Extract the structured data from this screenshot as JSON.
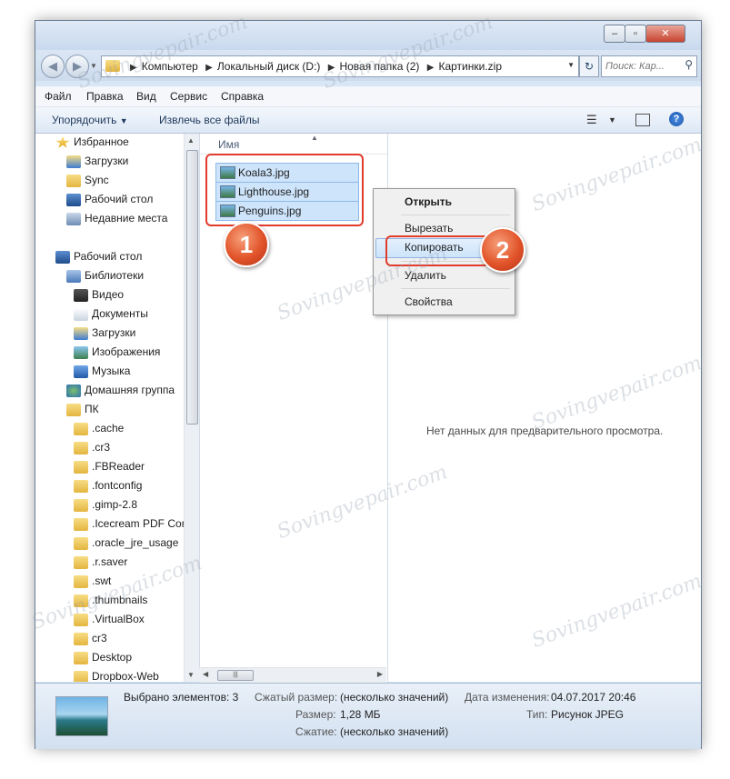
{
  "window": {
    "buttons": {
      "minimize": "–",
      "maximize": "▫",
      "close": "✕"
    }
  },
  "address": {
    "crumbs": [
      "Компьютер",
      "Локальный диск (D:)",
      "Новая папка (2)",
      "Картинки.zip"
    ],
    "search_placeholder": "Поиск: Кар..."
  },
  "menu": [
    "Файл",
    "Правка",
    "Вид",
    "Сервис",
    "Справка"
  ],
  "toolbar": {
    "organize": "Упорядочить",
    "extract": "Извлечь все файлы",
    "help": "?"
  },
  "nav": {
    "items": [
      {
        "label": "Избранное",
        "icon": "star-icon",
        "indent": 0
      },
      {
        "label": "Загрузки",
        "icon": "downloads-icon",
        "indent": 1
      },
      {
        "label": "Sync",
        "icon": "folder-icon",
        "indent": 1
      },
      {
        "label": "Рабочий стол",
        "icon": "desktop-icon",
        "indent": 1
      },
      {
        "label": "Недавние места",
        "icon": "recent-icon",
        "indent": 1
      },
      {
        "label": "Рабочий стол",
        "icon": "desktop-icon",
        "indent": 0
      },
      {
        "label": "Библиотеки",
        "icon": "libraries-icon",
        "indent": 1
      },
      {
        "label": "Видео",
        "icon": "video-icon",
        "indent": 2
      },
      {
        "label": "Документы",
        "icon": "documents-icon",
        "indent": 2
      },
      {
        "label": "Загрузки",
        "icon": "downloads-icon",
        "indent": 2
      },
      {
        "label": "Изображения",
        "icon": "images-icon",
        "indent": 2
      },
      {
        "label": "Музыка",
        "icon": "music-icon",
        "indent": 2
      },
      {
        "label": "Домашняя группа",
        "icon": "homegroup-icon",
        "indent": 1
      },
      {
        "label": "ПК",
        "icon": "folder-icon",
        "indent": 1
      },
      {
        "label": ".cache",
        "icon": "folder-icon",
        "indent": 2
      },
      {
        "label": ".cr3",
        "icon": "folder-icon",
        "indent": 2
      },
      {
        "label": ".FBReader",
        "icon": "folder-icon",
        "indent": 2
      },
      {
        "label": ".fontconfig",
        "icon": "folder-icon",
        "indent": 2
      },
      {
        "label": ".gimp-2.8",
        "icon": "folder-icon",
        "indent": 2
      },
      {
        "label": ".Icecream PDF Con",
        "icon": "folder-icon",
        "indent": 2
      },
      {
        "label": ".oracle_jre_usage",
        "icon": "folder-icon",
        "indent": 2
      },
      {
        "label": ".r.saver",
        "icon": "folder-icon",
        "indent": 2
      },
      {
        "label": ".swt",
        "icon": "folder-icon",
        "indent": 2
      },
      {
        "label": ".thumbnails",
        "icon": "folder-icon",
        "indent": 2
      },
      {
        "label": ".VirtualBox",
        "icon": "folder-icon",
        "indent": 2
      },
      {
        "label": "cr3",
        "icon": "folder-icon",
        "indent": 2
      },
      {
        "label": "Desktop",
        "icon": "folder-icon",
        "indent": 2
      },
      {
        "label": "Dropbox-Web",
        "icon": "folder-icon",
        "indent": 2
      }
    ]
  },
  "files": {
    "column": "Имя",
    "items": [
      "Koala3.jpg",
      "Lighthouse.jpg",
      "Penguins.jpg"
    ]
  },
  "context_menu": {
    "open": "Открыть",
    "cut": "Вырезать",
    "copy": "Копировать",
    "delete": "Удалить",
    "properties": "Свойства"
  },
  "preview": {
    "message": "Нет данных для предварительного просмотра."
  },
  "details": {
    "selected": "Выбрано элементов: 3",
    "compressed_label": "Сжатый размер:",
    "compressed_value": "(несколько значений)",
    "size_label": "Размер:",
    "size_value": "1,28 МБ",
    "compression_label": "Сжатие:",
    "compression_value": "(несколько значений)",
    "modified_label": "Дата изменения:",
    "modified_value": "04.07.2017 20:46",
    "type_label": "Тип:",
    "type_value": "Рисунок JPEG"
  },
  "annotations": {
    "step1": "1",
    "step2": "2"
  },
  "watermark": "Sovingvepair.com",
  "colors": {
    "accent": "#e03b2b",
    "selection": "#cde4fb"
  }
}
